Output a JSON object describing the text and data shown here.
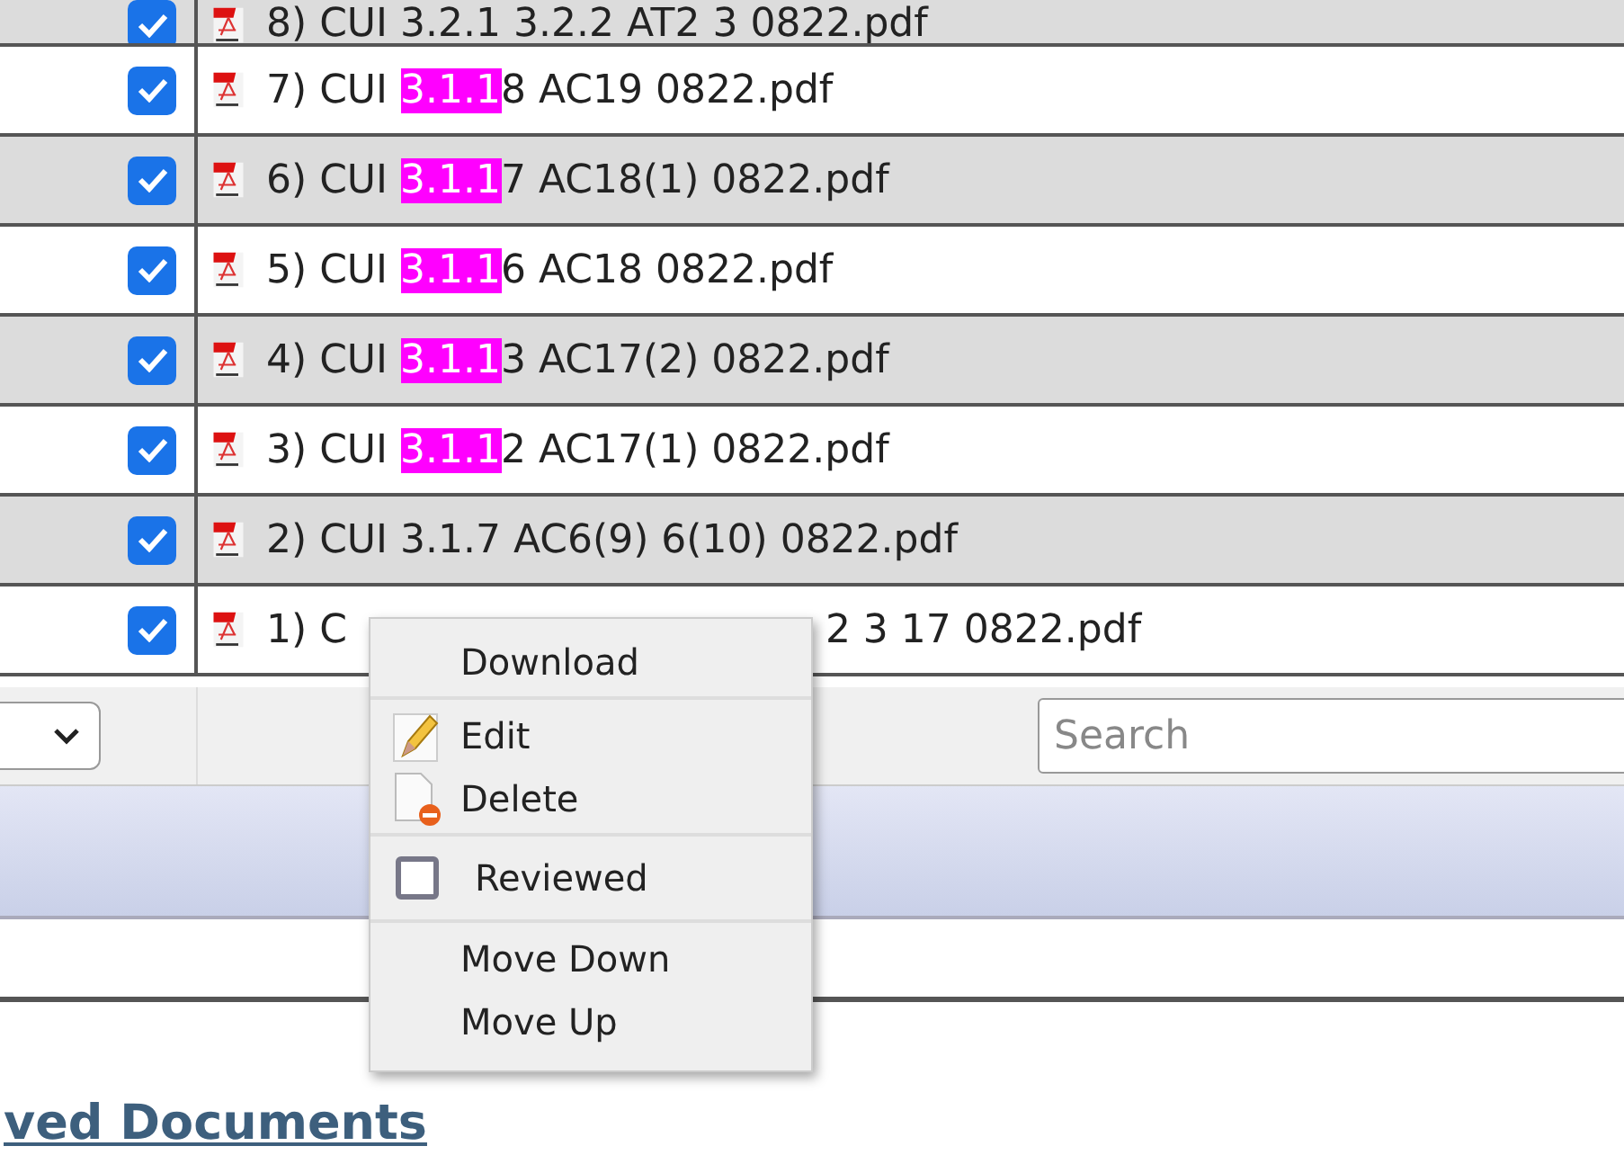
{
  "table": {
    "rows": [
      {
        "kind": "full",
        "checked": true,
        "segments": [
          {
            "text": "8) CUI 3.2.1 3.2.2 AT2 3 0822.pdf",
            "highlighted": false
          }
        ]
      },
      {
        "kind": "full",
        "checked": true,
        "segments": [
          {
            "text": "7) CUI ",
            "highlighted": false
          },
          {
            "text": "3.1.1",
            "highlighted": true
          },
          {
            "text": "8 AC19 0822.pdf",
            "highlighted": false
          }
        ]
      },
      {
        "kind": "full",
        "checked": true,
        "segments": [
          {
            "text": "6) CUI ",
            "highlighted": false
          },
          {
            "text": "3.1.1",
            "highlighted": true
          },
          {
            "text": "7 AC18(1) 0822.pdf",
            "highlighted": false
          }
        ]
      },
      {
        "kind": "full",
        "checked": true,
        "segments": [
          {
            "text": "5) CUI ",
            "highlighted": false
          },
          {
            "text": "3.1.1",
            "highlighted": true
          },
          {
            "text": "6 AC18 0822.pdf",
            "highlighted": false
          }
        ]
      },
      {
        "kind": "full",
        "checked": true,
        "segments": [
          {
            "text": "4) CUI ",
            "highlighted": false
          },
          {
            "text": "3.1.1",
            "highlighted": true
          },
          {
            "text": "3 AC17(2) 0822.pdf",
            "highlighted": false
          }
        ]
      },
      {
        "kind": "full",
        "checked": true,
        "segments": [
          {
            "text": "3) CUI ",
            "highlighted": false
          },
          {
            "text": "3.1.1",
            "highlighted": true
          },
          {
            "text": "2 AC17(1) 0822.pdf",
            "highlighted": false
          }
        ]
      },
      {
        "kind": "full",
        "checked": true,
        "segments": [
          {
            "text": "2) CUI 3.1.7 AC6(9) 6(10) 0822.pdf",
            "highlighted": false
          }
        ]
      },
      {
        "kind": "covered",
        "checked": true,
        "start": "1) C",
        "end": "2 3 17 0822.pdf"
      }
    ]
  },
  "footer": {
    "search": {
      "placeholder": "Search"
    }
  },
  "context_menu": {
    "groups": [
      [
        {
          "kind": "plain",
          "label": "Download"
        }
      ],
      [
        {
          "kind": "edit",
          "label": "Edit"
        },
        {
          "kind": "delete",
          "label": "Delete"
        }
      ],
      [
        {
          "kind": "checkbox",
          "label": "Reviewed",
          "checked": false
        }
      ],
      [
        {
          "kind": "plain",
          "label": "Move Down"
        },
        {
          "kind": "plain",
          "label": "Move Up"
        }
      ]
    ]
  },
  "section_link": "ved Documents"
}
